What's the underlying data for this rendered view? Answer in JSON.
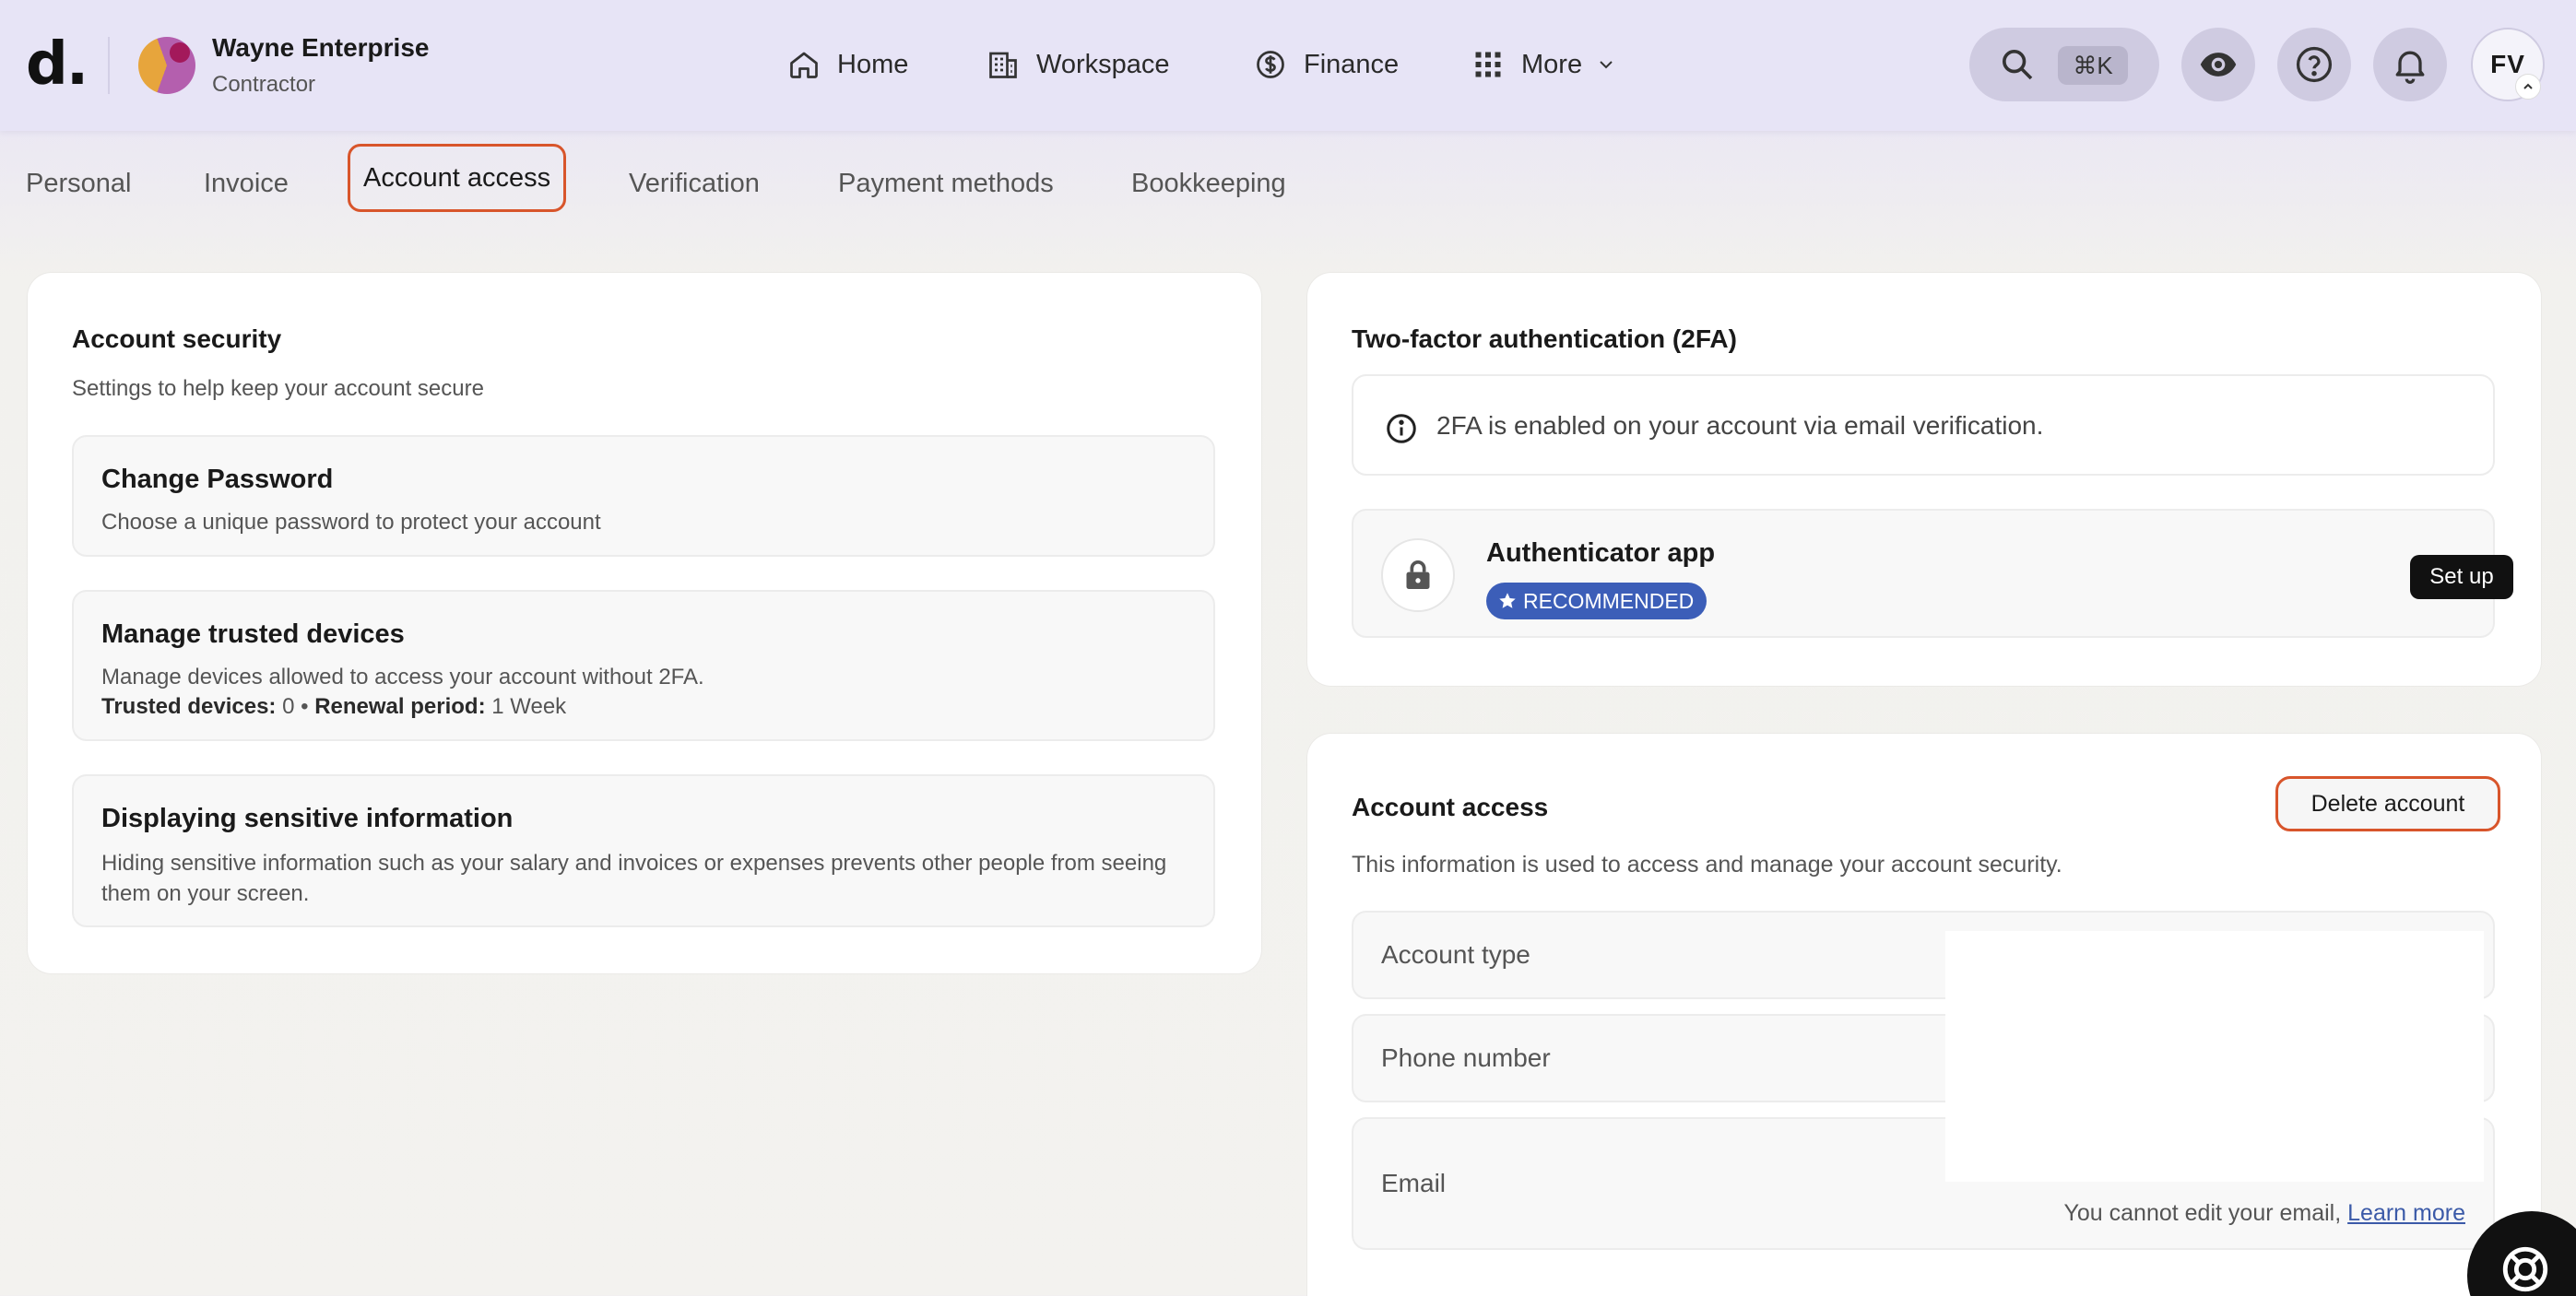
{
  "brand": {
    "logo_text": "d."
  },
  "organization": {
    "name": "Wayne Enterprise",
    "role": "Contractor"
  },
  "nav": {
    "home": "Home",
    "workspace": "Workspace",
    "finance": "Finance",
    "more": "More"
  },
  "search": {
    "shortcut": "⌘K"
  },
  "user": {
    "initials": "FV"
  },
  "tabs": {
    "personal": "Personal",
    "invoice": "Invoice",
    "account_access": "Account access",
    "verification": "Verification",
    "payment_methods": "Payment methods",
    "bookkeeping": "Bookkeeping"
  },
  "security": {
    "title": "Account security",
    "subtitle": "Settings to help keep your account secure",
    "change_password": {
      "title": "Change Password",
      "desc": "Choose a unique password to protect your account"
    },
    "trusted_devices": {
      "title": "Manage trusted devices",
      "desc": "Manage devices allowed to access your account without 2FA.",
      "devices_label": "Trusted devices:",
      "devices_value": "0",
      "separator": "•",
      "renewal_label": "Renewal period:",
      "renewal_value": "1 Week"
    },
    "sensitive": {
      "title": "Displaying sensitive information",
      "desc": "Hiding sensitive information such as your salary and invoices or expenses prevents other people from seeing them on your screen."
    }
  },
  "twofa": {
    "title": "Two-factor authentication (2FA)",
    "info": "2FA is enabled on your account via email verification.",
    "authenticator": {
      "title": "Authenticator app",
      "badge": "RECOMMENDED",
      "button": "Set up"
    }
  },
  "access": {
    "title": "Account access",
    "subtitle": "This information is used to access and manage your account security.",
    "delete_button": "Delete account",
    "fields": {
      "account_type": "Account type",
      "phone": "Phone number",
      "email": "Email"
    },
    "email_note": "You cannot edit your email,",
    "learn_more": "Learn more"
  },
  "colors": {
    "accent_outline": "#d8552b",
    "badge_blue": "#3c5eb8",
    "topbar_bg": "#e7e4f6"
  }
}
